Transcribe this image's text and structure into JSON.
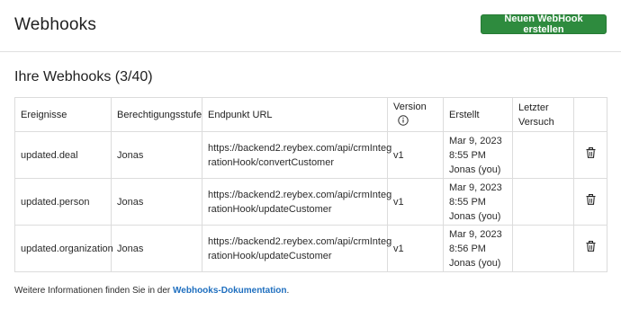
{
  "header": {
    "title": "Webhooks",
    "new_button": "Neuen WebHook erstellen"
  },
  "section": {
    "title": "Ihre Webhooks (3/40)"
  },
  "table": {
    "columns": [
      "Ereignisse",
      "Berechtigungsstufe",
      "Endpunkt URL",
      "Version",
      "Erstellt",
      "Letzter Versuch",
      ""
    ],
    "rows": [
      {
        "event": "updated.deal",
        "permission": "Jonas",
        "url_line1": "https://backend2.reybex.com/api/crmInteg",
        "url_line2": "rationHook/convertCustomer",
        "version": "v1",
        "created_date": "Mar 9, 2023",
        "created_time": "8:55 PM",
        "created_by": "Jonas (you)",
        "last_attempt": ""
      },
      {
        "event": "updated.person",
        "permission": "Jonas",
        "url_line1": "https://backend2.reybex.com/api/crmInteg",
        "url_line2": "rationHook/updateCustomer",
        "version": "v1",
        "created_date": "Mar 9, 2023",
        "created_time": "8:55 PM",
        "created_by": "Jonas (you)",
        "last_attempt": ""
      },
      {
        "event": "updated.organization",
        "permission": "Jonas",
        "url_line1": "https://backend2.reybex.com/api/crmInteg",
        "url_line2": "rationHook/updateCustomer",
        "version": "v1",
        "created_date": "Mar 9, 2023",
        "created_time": "8:56 PM",
        "created_by": "Jonas (you)",
        "last_attempt": ""
      }
    ]
  },
  "footer": {
    "text": "Weitere Informationen finden Sie in der ",
    "link": "Webhooks-Dokumentation",
    "suffix": "."
  },
  "colors": {
    "primary_button": "#2e8b3e",
    "link": "#1f6fbf",
    "border": "#dcdcdc"
  },
  "icons": {
    "version_info": "info-icon",
    "row_action": "trash-icon"
  }
}
